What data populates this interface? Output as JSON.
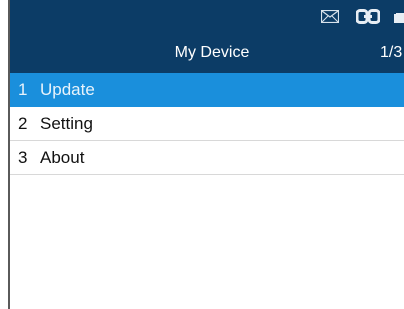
{
  "header": {
    "title": "My Device",
    "page_indicator": "1/3",
    "status_icons": [
      "mail-icon",
      "link-icon",
      "battery-icon"
    ]
  },
  "menu": {
    "items": [
      {
        "number": "1",
        "label": "Update",
        "selected": true
      },
      {
        "number": "2",
        "label": "Setting",
        "selected": false
      },
      {
        "number": "3",
        "label": "About",
        "selected": false
      }
    ]
  },
  "colors": {
    "header_bg": "#0c3c66",
    "selected_bg": "#1a8fdc",
    "divider": "#d8d8d8"
  }
}
